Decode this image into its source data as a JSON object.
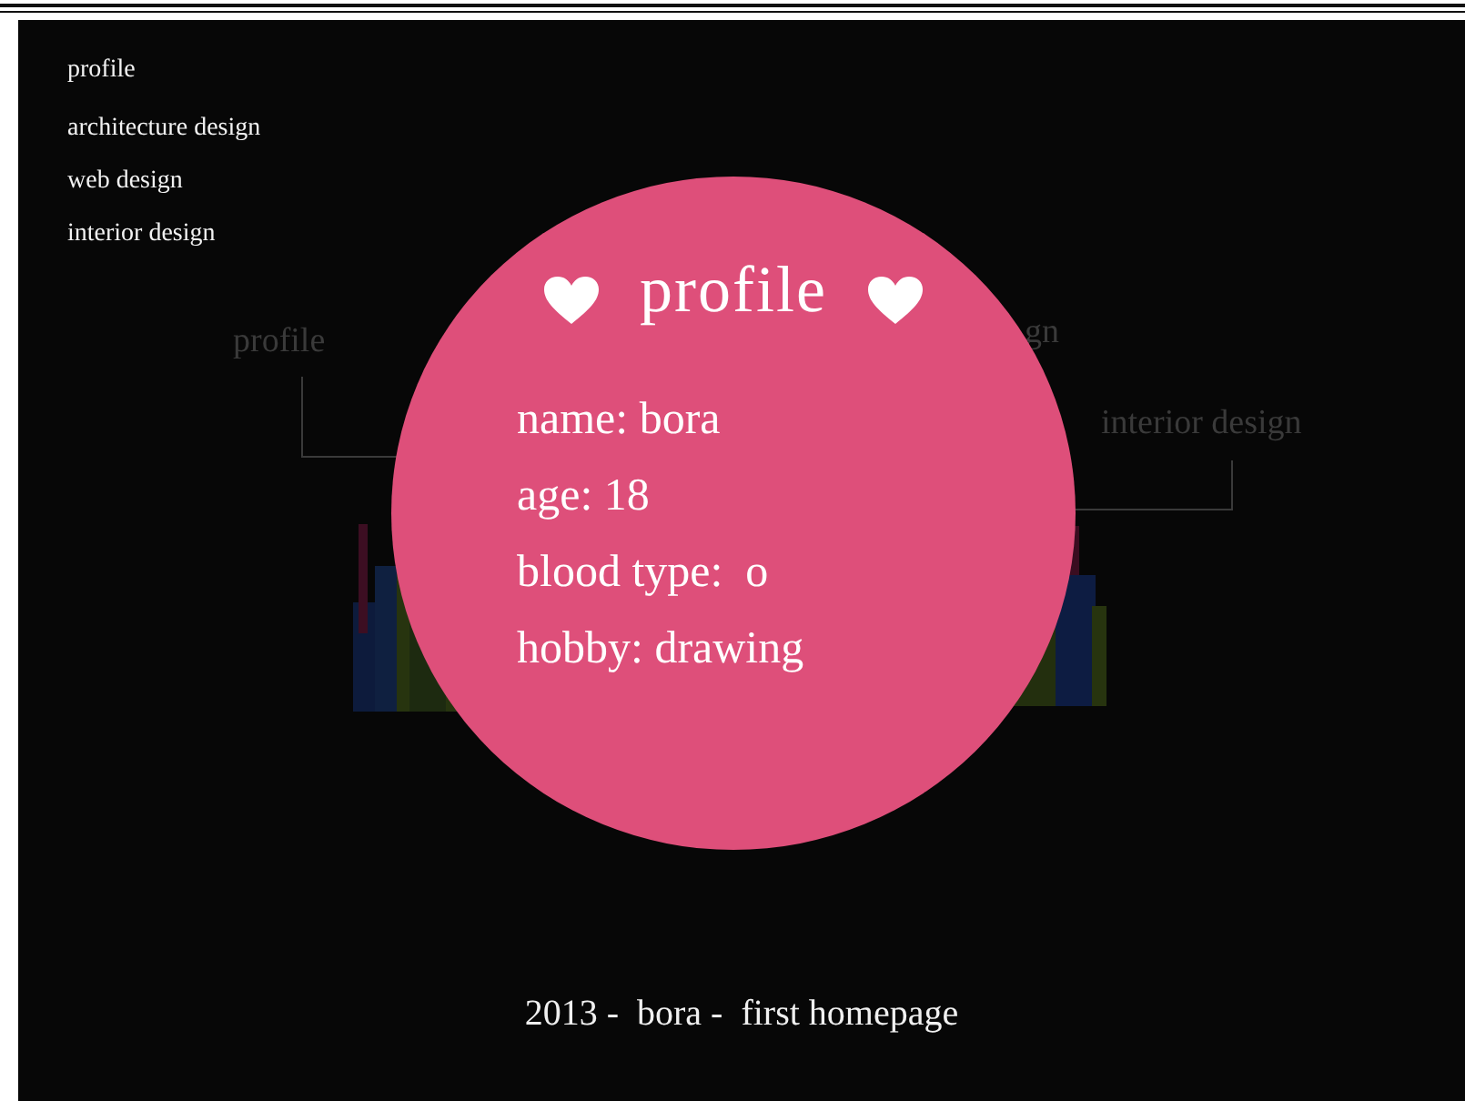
{
  "menu": [
    {
      "label": "profile"
    },
    {
      "label": "architecture design"
    },
    {
      "label": "web design"
    },
    {
      "label": "interior design"
    }
  ],
  "background_labels": [
    {
      "text": "profile"
    },
    {
      "text": "gn"
    },
    {
      "text": "interior design"
    }
  ],
  "card": {
    "title": "profile",
    "fields": [
      "name: bora",
      "age: 18",
      "blood type:  o",
      "hobby: drawing"
    ]
  },
  "footer": "2013 -  bora -  first homepage"
}
